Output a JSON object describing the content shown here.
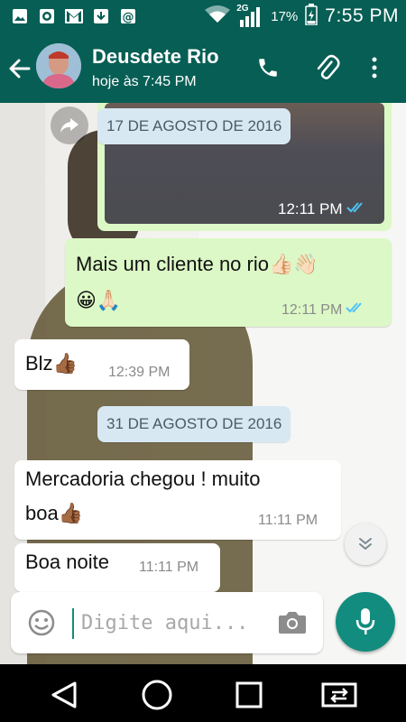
{
  "status_bar": {
    "network": "2G",
    "battery": "17%",
    "time": "7:55 PM"
  },
  "header": {
    "contact_name": "Deusdete Rio",
    "last_seen": "hoje às 7:45 PM"
  },
  "messages": [
    {
      "kind": "image",
      "direction": "outgoing",
      "time": "12:11 PM",
      "read": true
    },
    {
      "kind": "text",
      "direction": "outgoing",
      "line1": "Mais um cliente no rio👍🏻👋🏻",
      "line2": "😀🙏🏻",
      "time": "12:11 PM",
      "read": true
    },
    {
      "kind": "text",
      "direction": "incoming",
      "text": "Blz👍🏾",
      "time": "12:39 PM"
    },
    {
      "kind": "text",
      "direction": "incoming",
      "line1": "Mercadoria chegou ! muito",
      "line2": "boa👍🏾",
      "time": "11:11 PM"
    },
    {
      "kind": "text",
      "direction": "incoming",
      "text": "Boa noite",
      "time": "11:11 PM"
    }
  ],
  "date_separators": [
    "17 DE AGOSTO DE 2016",
    "31 DE AGOSTO DE 2016"
  ],
  "input": {
    "placeholder": "Digite aqui..."
  },
  "colors": {
    "primary": "#075e54",
    "accent": "#128c7e",
    "outgoing_bubble": "#dcf8c6",
    "incoming_bubble": "#ffffff",
    "read_ticks": "#4fc3f7",
    "date_chip": "#d7e8f3"
  },
  "icons": {
    "status_left": [
      "image-icon",
      "camera-shutter-icon",
      "gmail-icon",
      "download-icon",
      "email-at-icon"
    ],
    "status_right": [
      "wifi-icon",
      "signal-icon",
      "battery-icon"
    ],
    "header": [
      "back-arrow-icon",
      "phone-icon",
      "attachment-clip-icon",
      "more-vertical-icon"
    ],
    "chat": [
      "share-forward-icon",
      "double-chevron-down-icon",
      "double-check-icon"
    ],
    "input": [
      "emoji-icon",
      "camera-icon",
      "microphone-icon"
    ],
    "nav": [
      "back-triangle-icon",
      "home-circle-icon",
      "recents-square-icon",
      "switch-apps-icon"
    ]
  }
}
